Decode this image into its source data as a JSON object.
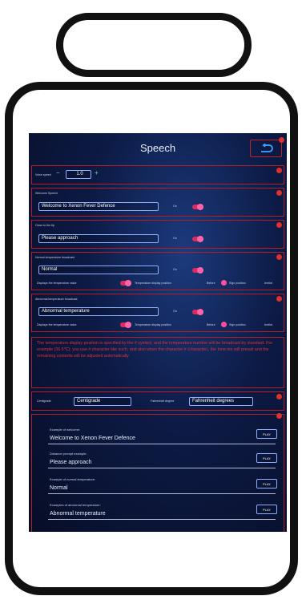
{
  "header": {
    "title": "Speech"
  },
  "voice_speed": {
    "label": "Voice speed",
    "value": "1.0",
    "minus": "−",
    "plus": "+"
  },
  "welcome": {
    "label": "Welcome Speech",
    "value": "Welcome to Xenon Fever Defence",
    "toggle_label": "On"
  },
  "close": {
    "label": "Close to the tip",
    "value": "Please approach",
    "toggle_label": "On"
  },
  "normal": {
    "label": "Normal temperature broadcast",
    "value": "Normal",
    "toggle_label": "On",
    "display_label": "Displays the temperature value",
    "position_label": "Temperature display position",
    "before": "Before",
    "after": "Sign position",
    "turned": "Ienthd"
  },
  "abnormal": {
    "label": "Abnormal temperature broadcast",
    "value": "Abnormal temperature",
    "toggle_label": "On",
    "display_label": "Displays the temperature value",
    "position_label": "Temperature display position",
    "before": "Before",
    "after": "Sign position",
    "turned": "Ienthd"
  },
  "note": "The temperature display position is specified by the # symbol, and the temperature number will be broadcast by standard. For example (36.5℃), you use # character like such, and also when the character # (character), the tone tex will prevail and the remaining contents will be adjusted automatically",
  "units": {
    "c_label": "Centigrade",
    "c_value": "Centigrade",
    "f_label": "Fahrenheit degree",
    "f_value": "Fahrenheit degrees"
  },
  "examples": [
    {
      "label": "Example of welcome:",
      "value": "Welcome to Xenon Fever Defence",
      "button": "PLAY"
    },
    {
      "label": "Distance prompt example:",
      "value": "Please approach",
      "button": "PLAY"
    },
    {
      "label": "Example of normal temperature:",
      "value": "Normal",
      "button": "PLAY"
    },
    {
      "label": "Examples of abnormal temperature:",
      "value": "Abnormal temperature",
      "button": "PLAY"
    }
  ],
  "colors": {
    "accent": "#d92c5f",
    "border": "#b32028",
    "note_text": "#e0303a"
  }
}
